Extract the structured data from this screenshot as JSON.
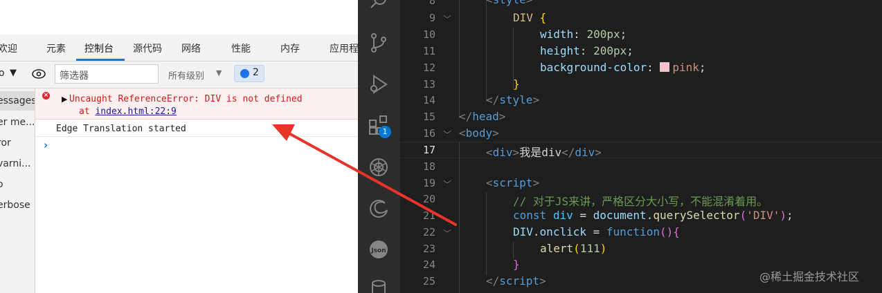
{
  "devtools": {
    "tabs": [
      {
        "label": "欢迎"
      },
      {
        "label": "元素"
      },
      {
        "label": "控制台"
      },
      {
        "label": "源代码"
      },
      {
        "label": "网络"
      },
      {
        "label": "性能"
      },
      {
        "label": "内存"
      },
      {
        "label": "应用程"
      }
    ],
    "active_tab_index": 2,
    "toolbar": {
      "context_label": "o",
      "filter_placeholder": "筛选器",
      "levels_label": "所有级别",
      "issues_count": "2"
    },
    "sidebar": {
      "items": [
        {
          "label": "essages"
        },
        {
          "label": "er me..."
        },
        {
          "label": "ror"
        },
        {
          "label": "varni..."
        },
        {
          "label": "o"
        },
        {
          "label": "erbose"
        }
      ]
    },
    "console": {
      "error_icon": "error-icon",
      "error_message": "Uncaught ReferenceError: DIV is not defined",
      "error_at_prefix": "at ",
      "error_location": "index.html:22:9",
      "log_message": "Edge Translation started",
      "prompt_symbol": "›"
    }
  },
  "editor": {
    "line_numbers": [
      "8",
      "9",
      "10",
      "11",
      "12",
      "13",
      "14",
      "15",
      "16",
      "17",
      "18",
      "19",
      "20",
      "21",
      "22",
      "23",
      "24",
      "25"
    ],
    "current_line": "17",
    "extensions_badge": "1",
    "lines": {
      "l8_open": "<",
      "l8_tag": "style",
      "l8_close": ">",
      "l9_selector": "DIV",
      "l9_brace": "{",
      "l10_prop": "width",
      "l10_val": "200px",
      "l11_prop": "height",
      "l11_val": "200px",
      "l12_prop": "background-color",
      "l12_val": "pink",
      "l13_brace": "}",
      "l14_tag": "style",
      "l15_tag": "head",
      "l16_tag": "body",
      "l17_tag": "div",
      "l17_text": "我是div",
      "l19_tag": "script",
      "l20_comment": "// 对于JS来讲，严格区分大小写，不能混淆着用。",
      "l21_kw": "const",
      "l21_var": "div",
      "l21_obj": "document",
      "l21_fn": "querySelector",
      "l21_str": "'DIV'",
      "l22_obj": "DIV",
      "l22_prop": "onclick",
      "l22_kw": "function",
      "l23_fn": "alert",
      "l23_num": "111",
      "l24_brace": "}",
      "l25_tag": "script"
    }
  },
  "watermark": "@稀土掘金技术社区",
  "colors": {
    "accent": "#1a73e8",
    "error_text": "#d31919",
    "error_bg": "#fdf0f0",
    "editor_bg": "#1e1e1e",
    "pink_swatch": "#ffc0cb",
    "arrow": "#e8322a"
  }
}
